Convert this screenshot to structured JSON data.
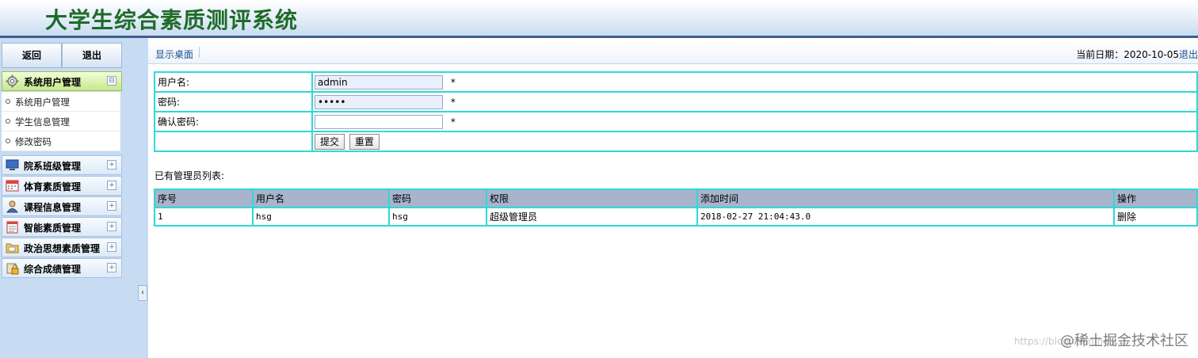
{
  "header": {
    "title": "大学生综合素质测评系统"
  },
  "sidebar": {
    "top_buttons": {
      "back": "返回",
      "exit": "退出"
    },
    "menus": [
      {
        "label": "系统用户管理",
        "toggle": "⊟",
        "icon": "gear-icon",
        "items": [
          {
            "label": "系统用户管理"
          },
          {
            "label": "学生信息管理"
          },
          {
            "label": "修改密码"
          }
        ]
      },
      {
        "label": "院系班级管理",
        "toggle": "+",
        "icon": "monitor-icon"
      },
      {
        "label": "体育素质管理",
        "toggle": "+",
        "icon": "calendar-icon"
      },
      {
        "label": "课程信息管理",
        "toggle": "+",
        "icon": "user-icon"
      },
      {
        "label": "智能素质管理",
        "toggle": "+",
        "icon": "notepad-icon"
      },
      {
        "label": "政治思想素质管理",
        "toggle": "+",
        "icon": "folder-icon"
      },
      {
        "label": "综合成绩管理",
        "toggle": "+",
        "icon": "lock-icon"
      }
    ],
    "collapse_glyph": "‹"
  },
  "topbar": {
    "desktop_link": "显示桌面",
    "date": "当前日期：2020-10-05",
    "logout": "退出"
  },
  "form": {
    "username_label": "用户名:",
    "username_value": "admin",
    "password_label": "密码:",
    "password_value": "•••••",
    "confirm_label": "确认密码:",
    "confirm_value": "",
    "required_mark": "*",
    "submit": "提交",
    "reset": "重置"
  },
  "admin_list": {
    "title": "已有管理员列表:",
    "columns": [
      "序号",
      "用户名",
      "密码",
      "权限",
      "添加时间",
      "操作"
    ],
    "rows": [
      [
        "1",
        "hsg",
        "hsg",
        "超级管理员",
        "2018-02-27 21:04:43.0",
        "删除"
      ]
    ]
  },
  "watermark": {
    "url": "https://blog.csdn.net/...",
    "text": "@稀土掘金技术社区"
  }
}
